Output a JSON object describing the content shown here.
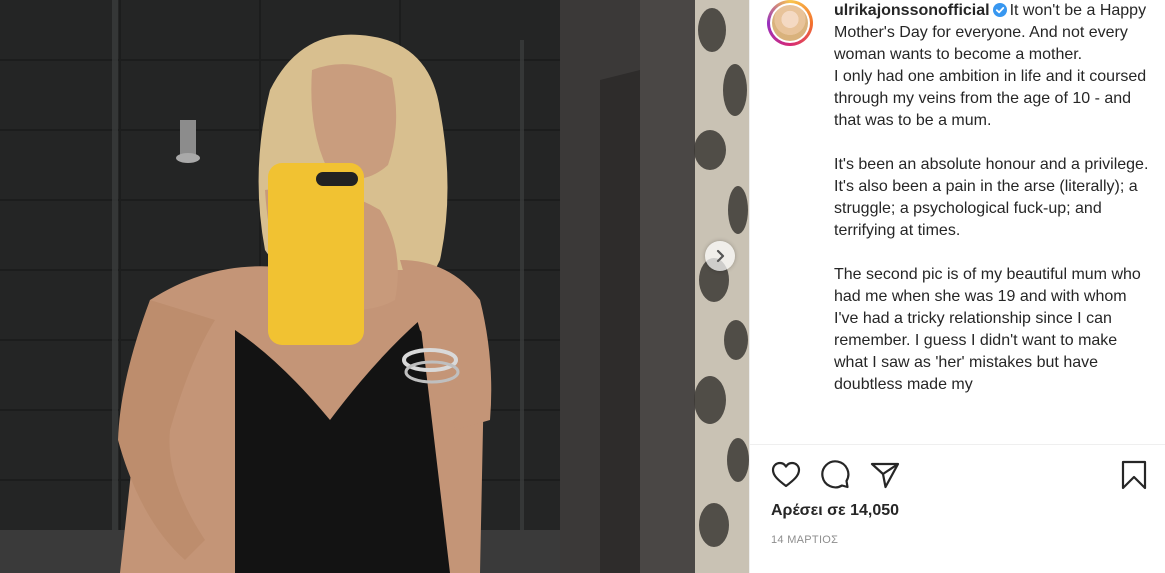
{
  "post": {
    "username": "ulrikajonssonofficial",
    "caption_first_line": "It won't be a Happy Mother's Day for everyone. And not every woman wants to become a mother.",
    "caption_lines": [
      "I only had one ambition in life and it coursed through my veins from the age of 10 - and that was to be a mum.",
      "",
      "It's been an absolute honour and a privilege.",
      "It's also been a pain in the arse (literally); a struggle; a psychological fuck-up; and terrifying at times.",
      "",
      "The second pic is of my beautiful mum who had me when she was 19 and with whom I've had a tricky relationship since I can remember. I guess I didn't want to make what I saw as 'her' mistakes but have doubtless made my"
    ],
    "likes_text": "Αρέσει σε 14,050",
    "date_text": "14 ΜΑΡΤΙΟΣ"
  },
  "icons": {
    "like": "heart-icon",
    "comment": "comment-icon",
    "share": "share-icon",
    "save": "bookmark-icon",
    "verified": "verified-badge-icon",
    "next": "chevron-right-icon"
  },
  "colors": {
    "verified_blue": "#3897f0",
    "phone_case": "#f1c232",
    "text": "#262626",
    "muted": "#8e8e8e"
  }
}
